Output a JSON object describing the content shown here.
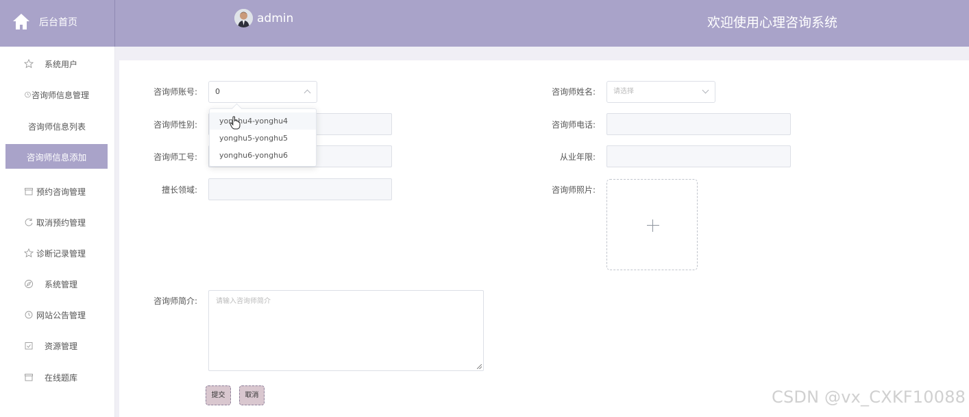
{
  "header": {
    "home_label": "后台首页",
    "user_name": "admin",
    "welcome": "欢迎使用心理咨询系统",
    "accent": "#a9a3c9"
  },
  "sidebar": {
    "items": [
      {
        "label": "系统用户",
        "icon": "star-icon"
      },
      {
        "label": "咨询师信息管理",
        "icon": "clock-icon"
      },
      {
        "label": "咨询师信息列表",
        "icon": ""
      },
      {
        "label": "咨询师信息添加",
        "icon": "",
        "active": true
      },
      {
        "label": "预约咨询管理",
        "icon": "box-icon"
      },
      {
        "label": "取消预约管理",
        "icon": "refresh-icon"
      },
      {
        "label": "诊断记录管理",
        "icon": "star-icon"
      },
      {
        "label": "系统管理",
        "icon": "compass-icon"
      },
      {
        "label": "网站公告管理",
        "icon": "clock-icon"
      },
      {
        "label": "资源管理",
        "icon": "calendar-check-icon"
      },
      {
        "label": "在线题库",
        "icon": "box-icon"
      }
    ]
  },
  "form": {
    "account_label": "咨询师账号:",
    "account_value": "0",
    "name_label": "咨询师姓名:",
    "name_placeholder": "请选择",
    "gender_label": "咨询师性别:",
    "phone_label": "咨询师电话:",
    "id_label": "咨询师工号:",
    "years_label": "从业年限:",
    "field_label": "擅长领域:",
    "photo_label": "咨询师照片:",
    "intro_label": "咨询师简介:",
    "intro_placeholder": "请输入咨询师简介",
    "submit": "提交",
    "cancel": "取消"
  },
  "dropdown": {
    "options": [
      "yonghu4-yonghu4",
      "yonghu5-yonghu5",
      "yonghu6-yonghu6"
    ]
  },
  "watermark": "CSDN @vx_CXKF10088"
}
